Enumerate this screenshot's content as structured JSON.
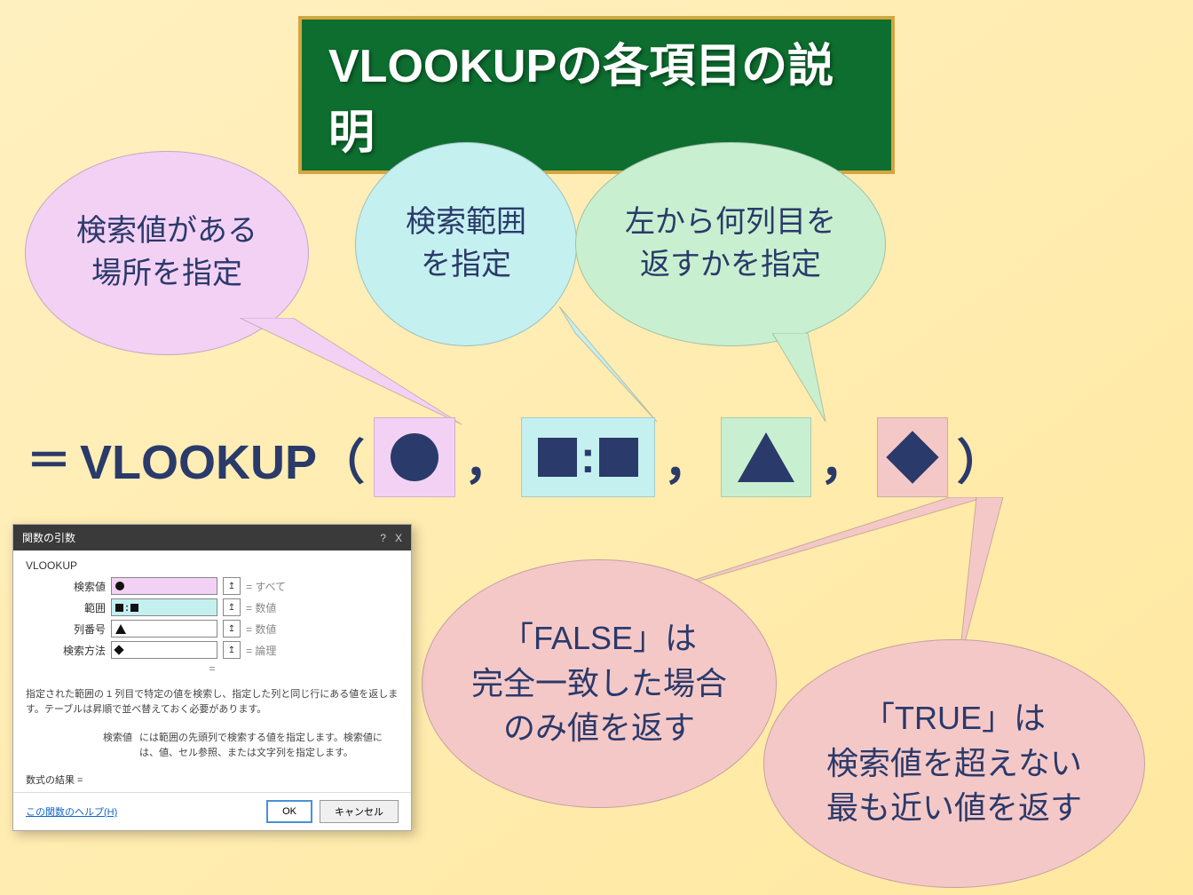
{
  "title": "VLOOKUPの各項目の説明",
  "bubbles": {
    "lookup_value": {
      "line1": "検索値がある",
      "line2": "場所を指定"
    },
    "range": {
      "line1": "検索範囲",
      "line2": "を指定"
    },
    "col": {
      "line1": "左から何列目を",
      "line2": "返すかを指定"
    },
    "false_desc": {
      "line1": "「FALSE」は",
      "line2": "完全一致した場合",
      "line3": "のみ値を返す"
    },
    "true_desc": {
      "line1": "「TRUE」は",
      "line2": "検索値を超えない",
      "line3": "最も近い値を返す"
    }
  },
  "formula": {
    "eq": "＝",
    "name": "VLOOKUP（",
    "close": "）"
  },
  "dialog": {
    "title": "関数の引数",
    "func_name": "VLOOKUP",
    "rows": {
      "r1_label": "検索値",
      "r1_hint": "= すべて",
      "r2_label": "範囲",
      "r2_hint": "= 数値",
      "r3_label": "列番号",
      "r3_hint": "= 数値",
      "r4_label": "検索方法",
      "r4_hint": "= 論理"
    },
    "eq_mid": "=",
    "desc1": "指定された範囲の 1 列目で特定の値を検索し、指定した列と同じ行にある値を返します。テーブルは昇順で並べ替えておく必要があります。",
    "desc2_label": "検索値",
    "desc2_text": "には範囲の先頭列で検索する値を指定します。検索値には、値、セル参照、または文字列を指定します。",
    "result_label": "数式の結果 =",
    "help_link": "この関数のヘルプ(H)",
    "ok": "OK",
    "cancel": "キャンセル"
  }
}
